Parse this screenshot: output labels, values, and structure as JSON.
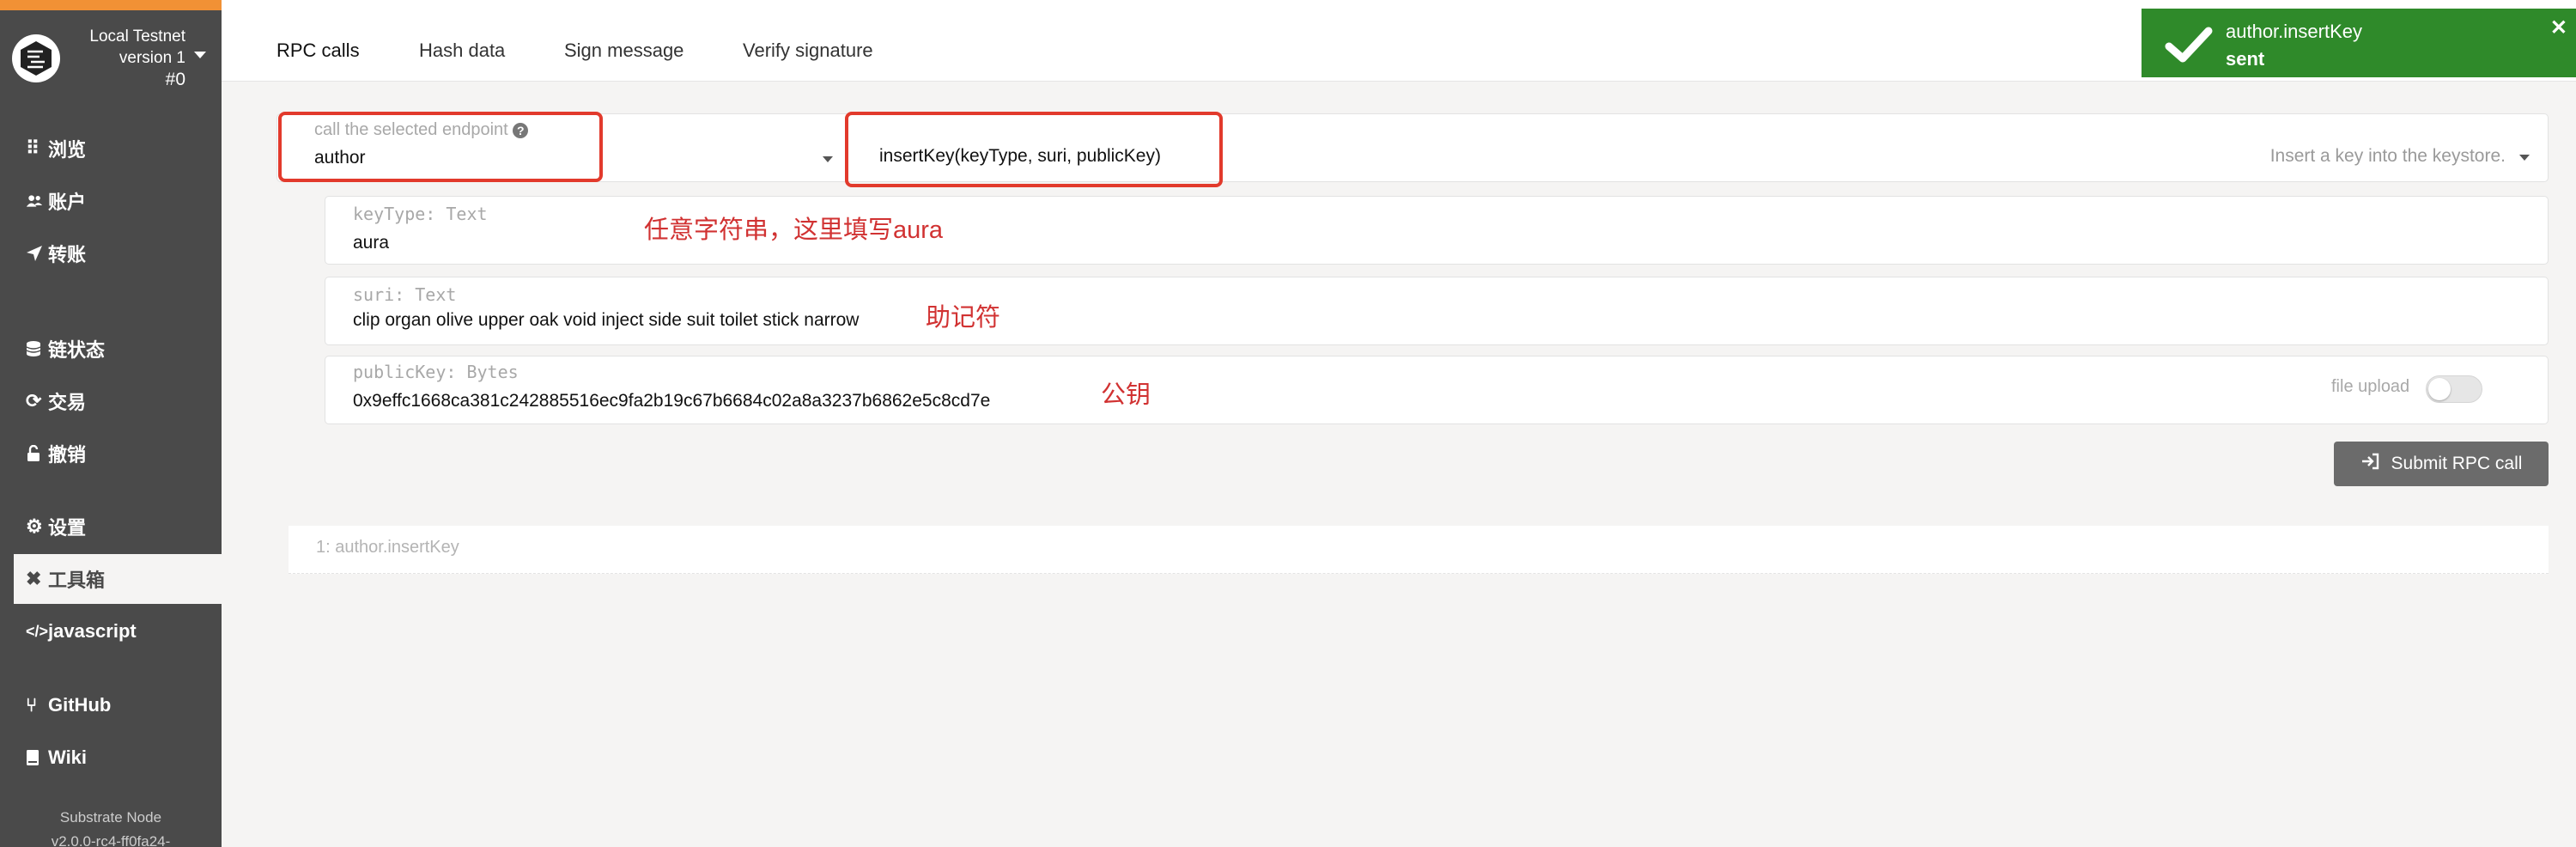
{
  "chain": {
    "name": "Local Testnet",
    "version": "version 1",
    "block": "#0"
  },
  "sidebar": {
    "items": [
      {
        "icon": "th-icon",
        "glyph": "⠿",
        "label": "浏览"
      },
      {
        "icon": "users-icon",
        "glyph": "👥",
        "label": "账户"
      },
      {
        "icon": "send-icon",
        "glyph": "➤",
        "label": "转账"
      },
      {
        "icon": "database-icon",
        "glyph": "☰",
        "label": "链状态"
      },
      {
        "icon": "sync-icon",
        "glyph": "⟳",
        "label": "交易"
      },
      {
        "icon": "unlock-icon",
        "glyph": "🔓",
        "label": "撤销"
      },
      {
        "icon": "settings-icon",
        "glyph": "⚙",
        "label": "设置"
      },
      {
        "icon": "tools-icon",
        "glyph": "✖",
        "label": "工具箱"
      },
      {
        "icon": "code-icon",
        "glyph": "</>",
        "label": "javascript"
      },
      {
        "icon": "github-icon",
        "glyph": "⑂",
        "label": "GitHub"
      },
      {
        "icon": "book-icon",
        "glyph": "▮",
        "label": "Wiki"
      }
    ],
    "footer": [
      "Substrate Node",
      "v2.0.0-rc4-ff0fa24-"
    ]
  },
  "tabs": [
    "RPC calls",
    "Hash data",
    "Sign message",
    "Verify signature"
  ],
  "rpc": {
    "endpoint_label": "call the selected endpoint",
    "endpoint_value": "author",
    "method_value": "insertKey(keyType, suri, publicKey)",
    "method_description": "Insert a key into the keystore.",
    "params": [
      {
        "label": "keyType: Text",
        "value": "aura",
        "annotation": "任意字符串，这里填写aura"
      },
      {
        "label": "suri: Text",
        "value": "clip organ olive upper oak void inject side suit toilet stick narrow",
        "annotation": "助记符"
      },
      {
        "label": "publicKey: Bytes",
        "value": "0x9effc1668ca381c242885516ec9fa2b19c67b6684c02a8a3237b6862e5c8cd7e",
        "annotation": "公钥"
      }
    ],
    "file_upload_label": "file upload",
    "submit_label": "Submit RPC call",
    "history_item": "1: author.insertKey"
  },
  "toast": {
    "title": "author.insertKey",
    "status": "sent"
  },
  "colors": {
    "sidebar": "#4a4a4a",
    "accent": "#f19135",
    "annotation": "#e23a2c",
    "toast": "#2f8a2a"
  }
}
